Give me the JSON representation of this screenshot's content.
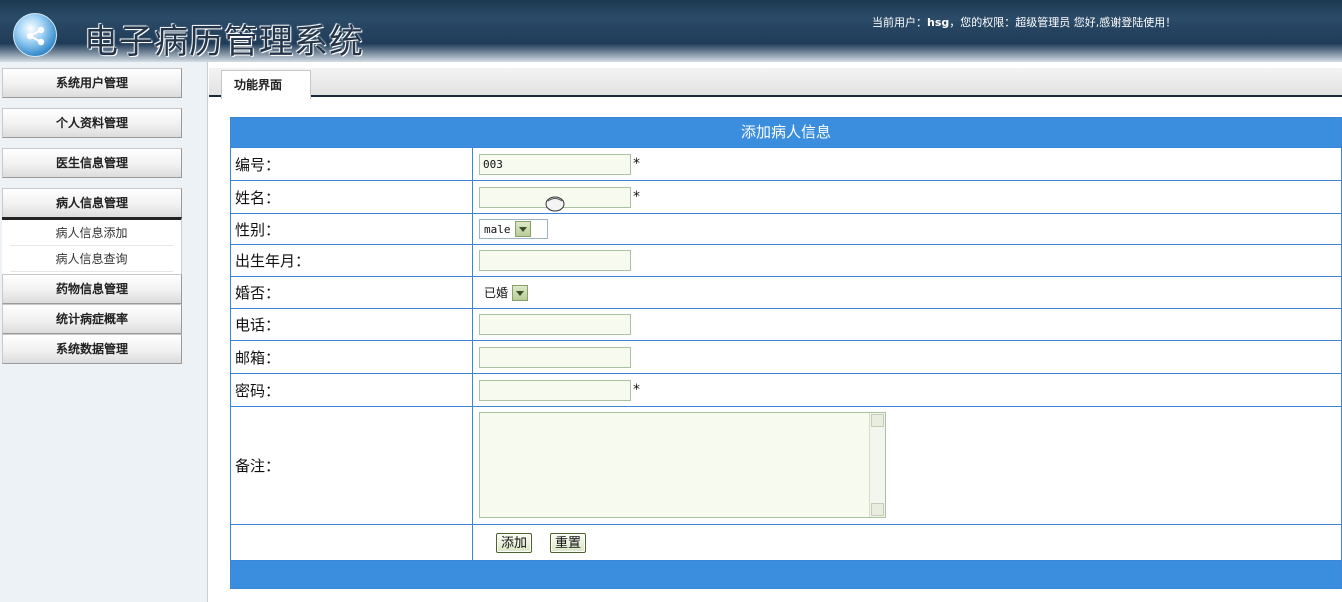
{
  "header": {
    "title": "电子病历管理系统",
    "user_prefix": "当前用户：",
    "username": "hsg",
    "role_text": "，您的权限：超级管理员  您好,感谢登陆使用！"
  },
  "sidebar": {
    "items": [
      {
        "label": "系统用户管理"
      },
      {
        "label": "个人资料管理"
      },
      {
        "label": "医生信息管理"
      },
      {
        "label": "病人信息管理"
      },
      {
        "label": "药物信息管理"
      },
      {
        "label": "统计病症概率"
      },
      {
        "label": "系统数据管理"
      }
    ],
    "submenu": [
      {
        "label": "病人信息添加"
      },
      {
        "label": "病人信息查询"
      }
    ]
  },
  "tab": {
    "label": "功能界面"
  },
  "form": {
    "title": "添加病人信息",
    "fields": {
      "id": {
        "label": "编号：",
        "value": "003"
      },
      "name": {
        "label": "姓名：",
        "value": ""
      },
      "gender": {
        "label": "性别：",
        "value": "male"
      },
      "birth": {
        "label": "出生年月：",
        "value": ""
      },
      "married": {
        "label": "婚否：",
        "value": "已婚"
      },
      "phone": {
        "label": "电话：",
        "value": ""
      },
      "email": {
        "label": "邮箱：",
        "value": ""
      },
      "password": {
        "label": "密码：",
        "value": ""
      },
      "note": {
        "label": "备注：",
        "value": ""
      }
    },
    "required_mark": "*",
    "buttons": {
      "add": "添加",
      "reset": "重置"
    }
  }
}
